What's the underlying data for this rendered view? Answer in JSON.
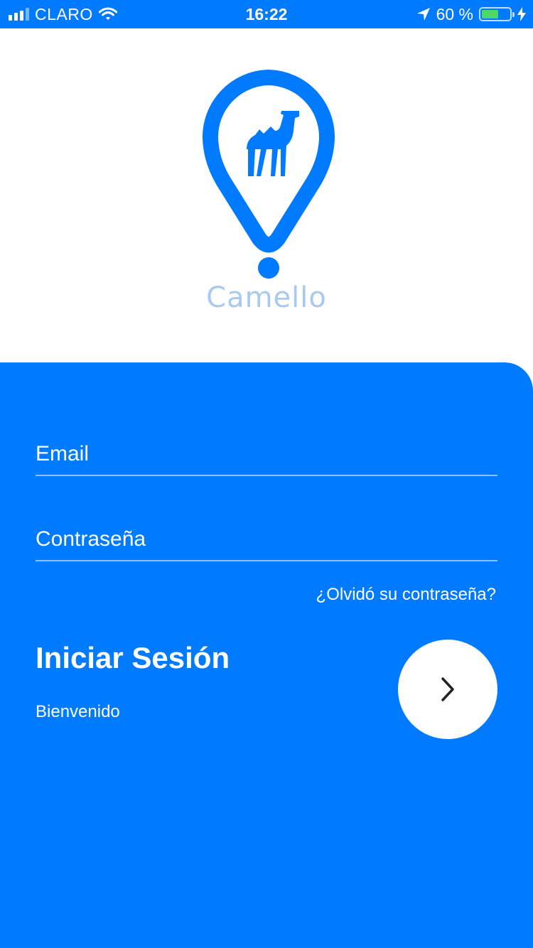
{
  "status_bar": {
    "carrier": "CLARO",
    "time": "16:22",
    "battery_percent_text": "60 %",
    "battery_level": 0.6,
    "icons": [
      "signal-bars-icon",
      "wifi-icon",
      "location-arrow-icon",
      "battery-icon",
      "charging-bolt-icon"
    ]
  },
  "logo": {
    "icon": "camel-map-pin-icon",
    "brand_name": "Camello"
  },
  "login": {
    "email_placeholder": "Email",
    "password_placeholder": "Contraseña",
    "forgot_password": "¿Olvidó su contraseña?",
    "title": "Iniciar Sesión",
    "subtitle": "Bienvenido",
    "submit_icon": "chevron-right-icon"
  },
  "colors": {
    "primary": "#007AFF",
    "brand_text": "#A9C9F0",
    "battery_fill": "#4CD964",
    "white": "#FFFFFF"
  }
}
